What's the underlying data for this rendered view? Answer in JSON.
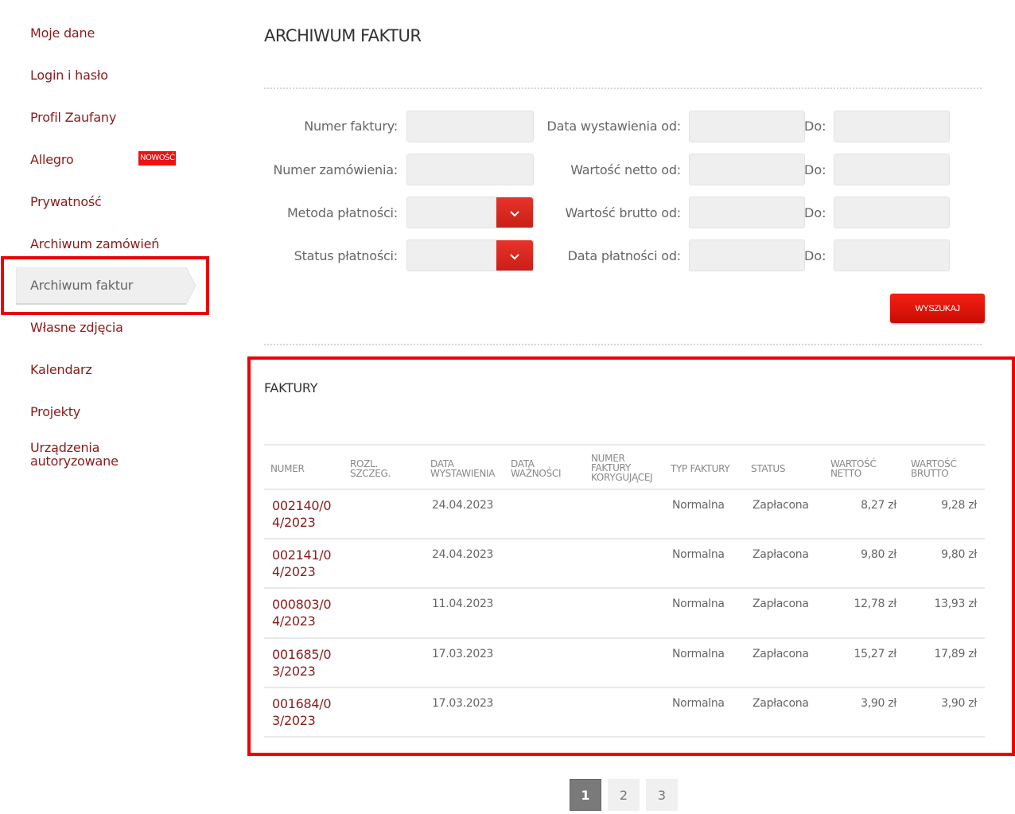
{
  "sidebar": {
    "items": [
      {
        "label": "Moje dane"
      },
      {
        "label": "Login i hasło"
      },
      {
        "label": "Profil Zaufany"
      },
      {
        "label": "Allegro",
        "badge": "NOWOŚĆ"
      },
      {
        "label": "Prywatność"
      },
      {
        "label": "Archiwum zamówień"
      },
      {
        "label": "Archiwum faktur",
        "active": true
      },
      {
        "label": "Własne zdjęcia"
      },
      {
        "label": "Kalendarz"
      },
      {
        "label": "Projekty"
      },
      {
        "label": "Urządzenia autoryzowane"
      }
    ]
  },
  "main": {
    "title": "ARCHIWUM FAKTUR",
    "filters": {
      "invoice_number_label": "Numer faktury:",
      "invoice_number_value": "",
      "order_number_label": "Numer zamówienia:",
      "order_number_value": "",
      "payment_method_label": "Metoda płatności:",
      "payment_method_value": "",
      "payment_status_label": "Status płatności:",
      "payment_status_value": "",
      "issue_date_from_label": "Data wystawienia od:",
      "net_value_from_label": "Wartość netto od:",
      "gross_value_from_label": "Wartość brutto od:",
      "payment_date_from_label": "Data płatności od:",
      "to_label": "Do:",
      "search_button": "WYSZUKAJ"
    },
    "invoices": {
      "title": "FAKTURY",
      "columns": [
        "NUMER",
        "ROZL. SZCZEG.",
        "DATA WYSTAWIENIA",
        "DATA WAŻNOŚCI",
        "NUMER FAKTURY KORYGUJĄCEJ",
        "TYP FAKTURY",
        "STATUS",
        "WARTOŚĆ NETTO",
        "WARTOŚĆ BRUTTO"
      ],
      "rows": [
        {
          "number": "002140/04/2023",
          "details": "",
          "issue_date": "24.04.2023",
          "due_date": "",
          "correction": "",
          "type": "Normalna",
          "status": "Zapłacona",
          "net": "8,27 zł",
          "gross": "9,28 zł"
        },
        {
          "number": "002141/04/2023",
          "details": "",
          "issue_date": "24.04.2023",
          "due_date": "",
          "correction": "",
          "type": "Normalna",
          "status": "Zapłacona",
          "net": "9,80 zł",
          "gross": "9,80 zł"
        },
        {
          "number": "000803/04/2023",
          "details": "",
          "issue_date": "11.04.2023",
          "due_date": "",
          "correction": "",
          "type": "Normalna",
          "status": "Zapłacona",
          "net": "12,78 zł",
          "gross": "13,93 zł"
        },
        {
          "number": "001685/03/2023",
          "details": "",
          "issue_date": "17.03.2023",
          "due_date": "",
          "correction": "",
          "type": "Normalna",
          "status": "Zapłacona",
          "net": "15,27 zł",
          "gross": "17,89 zł"
        },
        {
          "number": "001684/03/2023",
          "details": "",
          "issue_date": "17.03.2023",
          "due_date": "",
          "correction": "",
          "type": "Normalna",
          "status": "Zapłacona",
          "net": "3,90 zł",
          "gross": "3,90 zł"
        }
      ]
    },
    "pagination": {
      "pages": [
        "1",
        "2",
        "3"
      ],
      "current": "1"
    }
  },
  "colors": {
    "accent": "#e8332a",
    "link": "#8b1a1a",
    "highlight": "#ee0000",
    "badge": "#ee1111"
  }
}
